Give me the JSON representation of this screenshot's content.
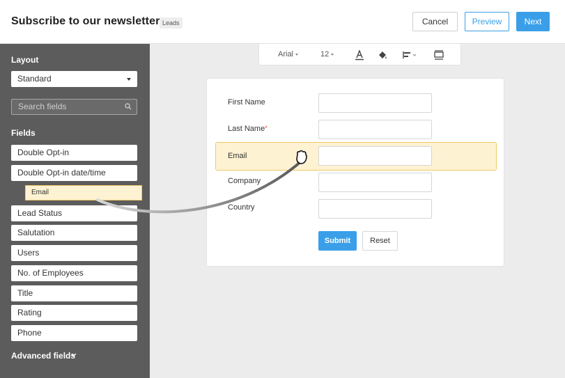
{
  "header": {
    "title": "Subscribe to our newsletter",
    "badge": "Leads",
    "cancel_label": "Cancel",
    "preview_label": "Preview",
    "next_label": "Next"
  },
  "sidebar": {
    "layout_heading": "Layout",
    "layout_value": "Standard",
    "search_placeholder": "Search fields",
    "fields_heading": "Fields",
    "fields": [
      "Double Opt-in",
      "Double Opt-in date/time",
      "Lead Status",
      "Salutation",
      "Users",
      "No. of Employees",
      "Title",
      "Rating",
      "Phone"
    ],
    "dragging_field": "Email",
    "advanced_label": "Advanced fields"
  },
  "toolbar": {
    "font_family": "Arial",
    "font_size": "12",
    "icons": [
      "text-color-icon",
      "fill-color-icon",
      "align-icon",
      "layout-icon"
    ]
  },
  "form": {
    "fields": [
      {
        "label": "First Name",
        "required": false
      },
      {
        "label": "Last Name",
        "required": true
      },
      {
        "label": "Email",
        "required": false
      },
      {
        "label": "Company",
        "required": false
      },
      {
        "label": "Country",
        "required": false
      }
    ],
    "required_mark": "*",
    "submit_label": "Submit",
    "reset_label": "Reset"
  },
  "colors": {
    "accent": "#3a9fe8",
    "sidebar_bg": "#5c5c5c",
    "highlight_bg": "#fdf2d2",
    "highlight_border": "#f0c866",
    "required": "#e0482b"
  }
}
